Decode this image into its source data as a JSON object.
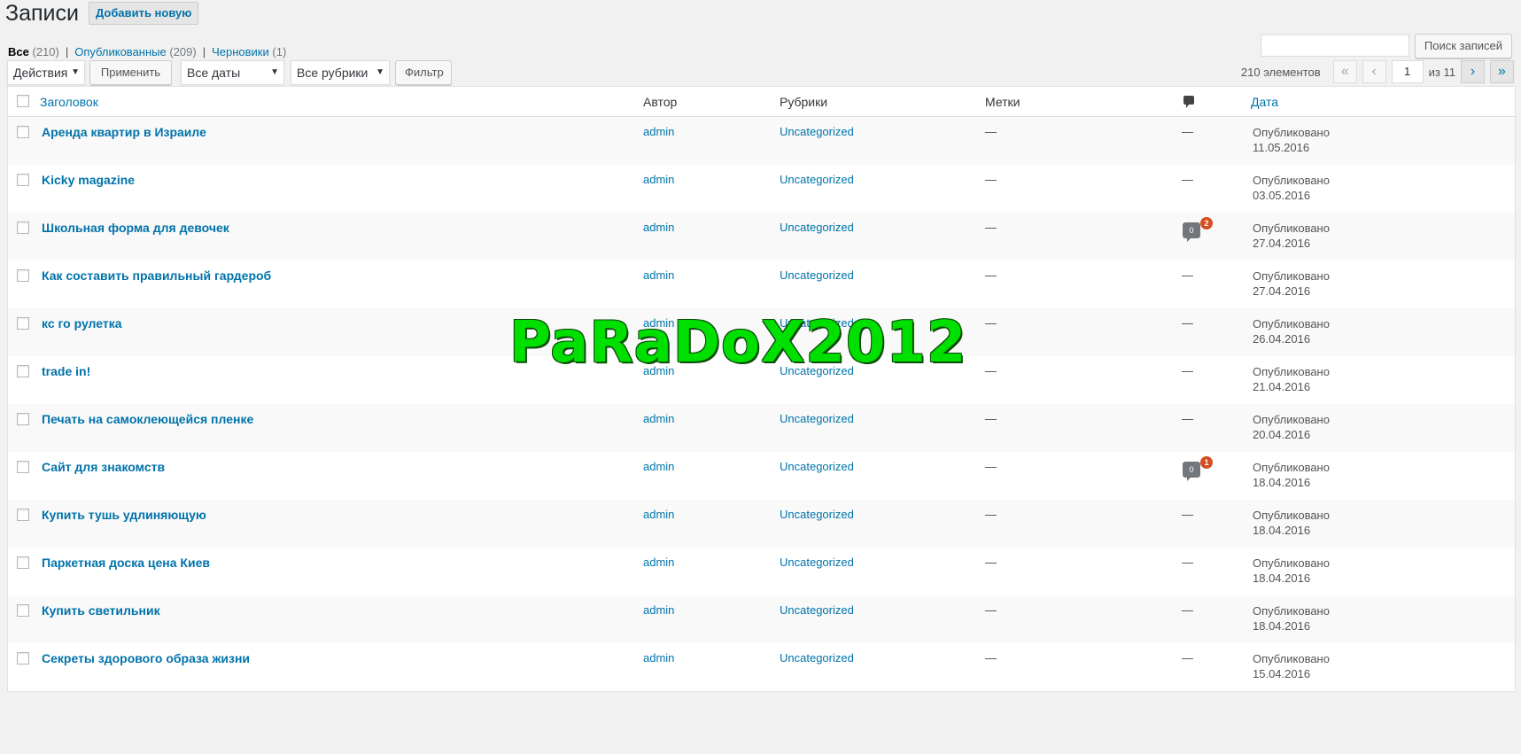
{
  "header": {
    "title": "Записи",
    "add_new": "Добавить новую"
  },
  "filters": {
    "all": {
      "label": "Все",
      "count": "(210)"
    },
    "published": {
      "label": "Опубликованные",
      "count": "(209)"
    },
    "drafts": {
      "label": "Черновики",
      "count": "(1)"
    },
    "separator": "|"
  },
  "search": {
    "value": "",
    "button": "Поиск записей"
  },
  "tablenav": {
    "bulk_actions": "Действия",
    "apply": "Применить",
    "dates": "Все даты",
    "categories": "Все рубрики",
    "filter": "Фильтр",
    "items_count": "210 элементов",
    "first": "«",
    "prev": "‹",
    "current_page": "1",
    "of_pages": "из 11",
    "next": "›",
    "last": "»"
  },
  "columns": {
    "title": "Заголовок",
    "author": "Автор",
    "categories": "Рубрики",
    "tags": "Метки",
    "comments_icon": "comment-icon",
    "date": "Дата"
  },
  "posts": [
    {
      "title": "Аренда квартир в Израиле",
      "author": "admin",
      "category": "Uncategorized",
      "tags": "—",
      "comments": "—",
      "status": "Опубликовано",
      "date": "11.05.2016"
    },
    {
      "title": "Kicky magazine",
      "author": "admin",
      "category": "Uncategorized",
      "tags": "—",
      "comments": "—",
      "status": "Опубликовано",
      "date": "03.05.2016"
    },
    {
      "title": "Школьная форма для девочек",
      "author": "admin",
      "category": "Uncategorized",
      "tags": "—",
      "comments": "0",
      "pending": "2",
      "status": "Опубликовано",
      "date": "27.04.2016"
    },
    {
      "title": "Как составить правильный гардероб",
      "author": "admin",
      "category": "Uncategorized",
      "tags": "—",
      "comments": "—",
      "status": "Опубликовано",
      "date": "27.04.2016"
    },
    {
      "title": "кс го рулетка",
      "author": "admin",
      "category": "Uncategorized",
      "tags": "—",
      "comments": "—",
      "status": "Опубликовано",
      "date": "26.04.2016"
    },
    {
      "title": "trade in!",
      "author": "admin",
      "category": "Uncategorized",
      "tags": "—",
      "comments": "—",
      "status": "Опубликовано",
      "date": "21.04.2016"
    },
    {
      "title": "Печать на самоклеющейся пленке",
      "author": "admin",
      "category": "Uncategorized",
      "tags": "—",
      "comments": "—",
      "status": "Опубликовано",
      "date": "20.04.2016"
    },
    {
      "title": "Сайт для знакомств",
      "author": "admin",
      "category": "Uncategorized",
      "tags": "—",
      "comments": "0",
      "pending": "1",
      "status": "Опубликовано",
      "date": "18.04.2016"
    },
    {
      "title": "Купить тушь удлиняющую",
      "author": "admin",
      "category": "Uncategorized",
      "tags": "—",
      "comments": "—",
      "status": "Опубликовано",
      "date": "18.04.2016"
    },
    {
      "title": "Паркетная доска цена Киев",
      "author": "admin",
      "category": "Uncategorized",
      "tags": "—",
      "comments": "—",
      "status": "Опубликовано",
      "date": "18.04.2016"
    },
    {
      "title": "Купить светильник",
      "author": "admin",
      "category": "Uncategorized",
      "tags": "—",
      "comments": "—",
      "status": "Опубликовано",
      "date": "18.04.2016"
    },
    {
      "title": "Секреты здорового образа жизни",
      "author": "admin",
      "category": "Uncategorized",
      "tags": "—",
      "comments": "—",
      "status": "Опубликовано",
      "date": "15.04.2016"
    }
  ],
  "watermark": "PaRaDoX2012",
  "colors": {
    "link": "#0073aa",
    "pending_badge": "#d54e21",
    "watermark": "#00e000"
  }
}
